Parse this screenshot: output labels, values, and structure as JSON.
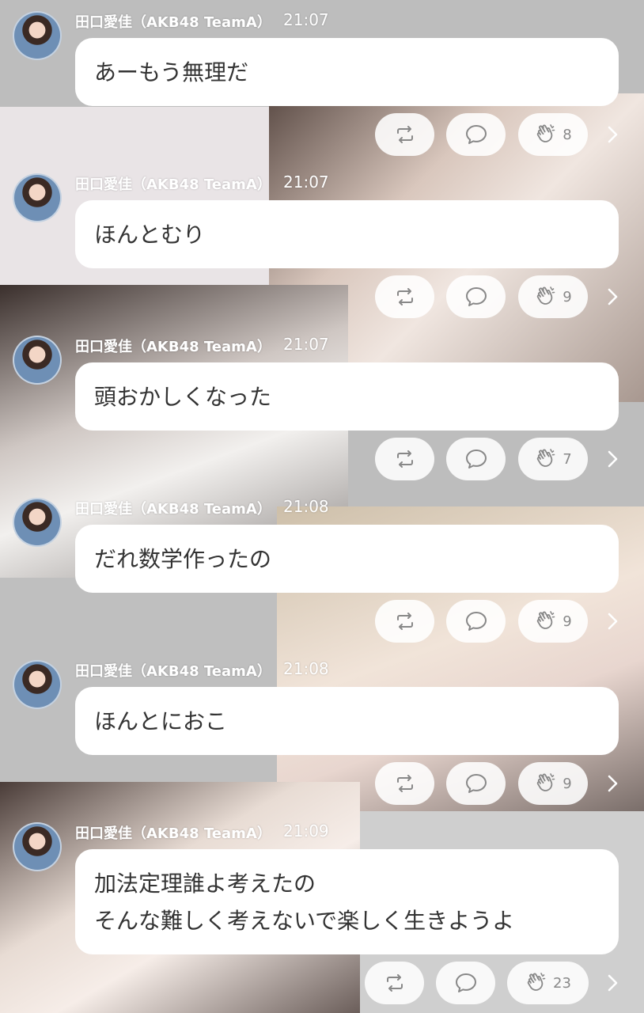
{
  "messages": [
    {
      "author": "田口愛佳（AKB48 TeamA）",
      "time": "21:07",
      "text": "あーもう無理だ",
      "claps": "8"
    },
    {
      "author": "田口愛佳（AKB48 TeamA）",
      "time": "21:07",
      "text": "ほんとむり",
      "claps": "9"
    },
    {
      "author": "田口愛佳（AKB48 TeamA）",
      "time": "21:07",
      "text": "頭おかしくなった",
      "claps": "7"
    },
    {
      "author": "田口愛佳（AKB48 TeamA）",
      "time": "21:08",
      "text": "だれ数学作ったの",
      "claps": "9"
    },
    {
      "author": "田口愛佳（AKB48 TeamA）",
      "time": "21:08",
      "text": "ほんとにおこ",
      "claps": "9"
    },
    {
      "author": "田口愛佳（AKB48 TeamA）",
      "time": "21:09",
      "text": "加法定理誰よ考えたの\nそんな難しく考えないで楽しく生きようよ",
      "claps": "23"
    }
  ],
  "icons": {
    "repost": "repost-icon",
    "comment": "comment-icon",
    "clap": "clap-icon",
    "more": "chevron-right-icon"
  },
  "colors": {
    "bubble": "#ffffff",
    "text": "#333333",
    "meta": "#ffffff",
    "count": "#888888"
  }
}
